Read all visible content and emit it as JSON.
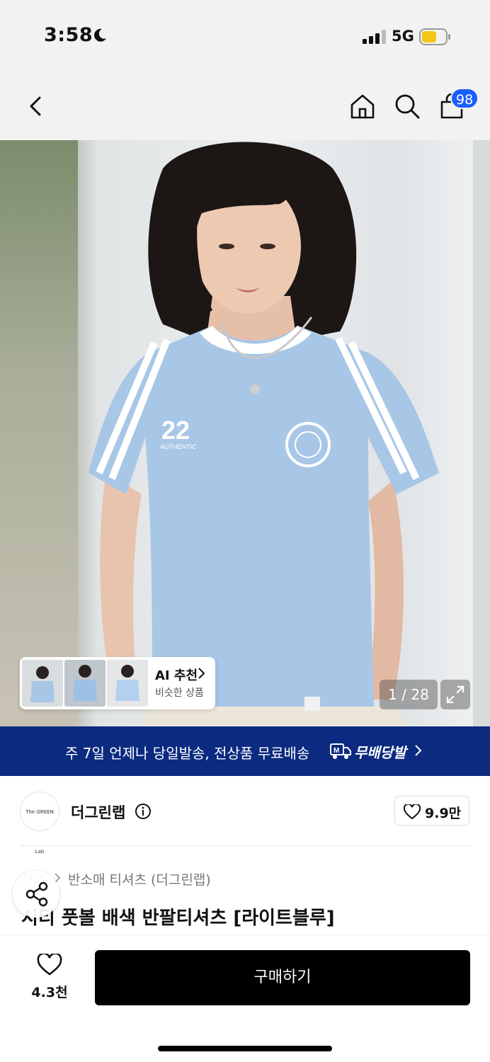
{
  "status_bar": {
    "time": "3:58",
    "network": "5G",
    "battery_color": "#f5c518"
  },
  "nav": {
    "back_icon": "chevron-left-icon",
    "home_icon": "home-icon",
    "search_icon": "search-icon",
    "bag_icon": "shopping-bag-icon",
    "cart_badge": "98",
    "badge_color": "#1a5cff"
  },
  "hero": {
    "counter": "1 / 28",
    "ai_recommend": {
      "title": "AI 추천",
      "subtitle": "비슷한 상품"
    }
  },
  "promo": {
    "text": "주 7일 언제나 당일발송, 전상품 무료배송",
    "brand": "무배당발",
    "background": "#0b2a80"
  },
  "brand": {
    "logo_text": "The GREEN Lab",
    "name": "더그린랩",
    "favorite_count": "9.9만"
  },
  "product": {
    "breadcrumb_root": "상의",
    "breadcrumb_category": "반소매 티셔츠 (더그린랩)",
    "title": "시티 풋볼 배색 반팔티셔츠 [라이트블루]"
  },
  "bottom_bar": {
    "like_count": "4.3천",
    "buy_label": "구매하기"
  }
}
